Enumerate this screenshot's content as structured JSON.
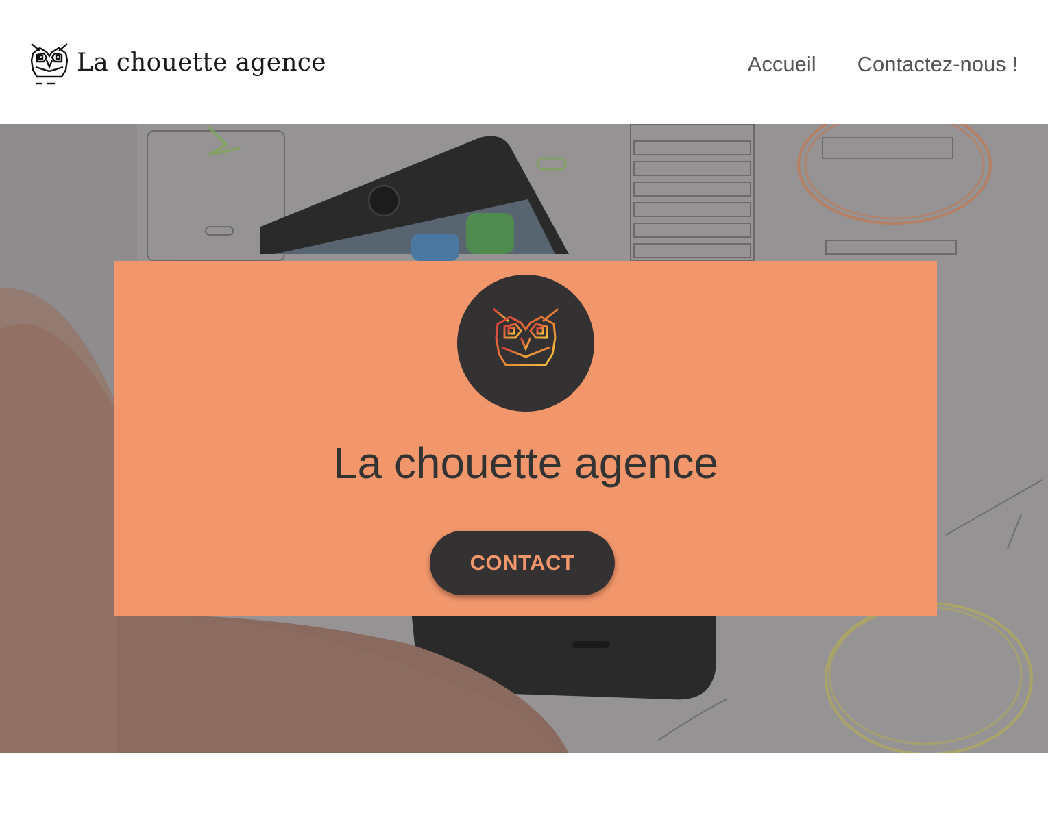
{
  "header": {
    "brand_name": "La chouette agence",
    "logo_icon": "owl-icon",
    "nav": [
      {
        "label": "Accueil"
      },
      {
        "label": "Contactez-nous !"
      }
    ]
  },
  "hero": {
    "background": "wireframe-sketches-and-smartphone-photo",
    "card": {
      "logo_icon": "owl-icon",
      "title": "La chouette agence",
      "button_label": "CONTACT"
    }
  },
  "colors": {
    "accent": "#f2966b",
    "dark": "#333132",
    "text": "#333333",
    "nav_text": "#555555",
    "owl_gradient_start": "#d63b3b",
    "owl_gradient_end": "#f5c43a"
  }
}
